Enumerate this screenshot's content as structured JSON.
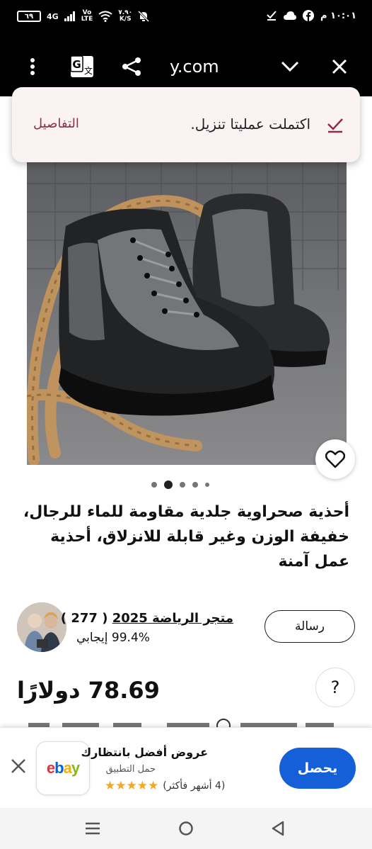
{
  "status_bar": {
    "battery": "٦٩",
    "network": "4G",
    "volte_top": "Vo",
    "volte_bottom": "LTE",
    "speed_top": "٧.٩٠",
    "speed_bottom": "K/S",
    "time": "١٠:٠١ م"
  },
  "toolbar": {
    "url": "y.com"
  },
  "download_snackbar": {
    "message": "اكتملت عمليتا تنزيل.",
    "details_label": "التفاصيل"
  },
  "product": {
    "title": "أحذية صحراوية جلدية مقاومة للماء للرجال، خفيفة الوزن وغير قابلة للانزلاق، أحذية عمل آمنة",
    "image_count": 5,
    "active_image_index": 1,
    "price": "78.69 دولارًا",
    "help_icon_text": "?"
  },
  "seller": {
    "name": "متجر الرياضة 2025",
    "rating_count": "( 277 )",
    "positive_feedback": "99.4% إيجابي",
    "message_button": "رسالة"
  },
  "app_banner": {
    "title": "عروض أفضل بانتظارك",
    "subtitle": "حمل التطبيق",
    "stars": "★★★★★",
    "rating_note": "(4 أشهر فأكثر)",
    "get_button": "يحصل",
    "logo_letters": [
      "e",
      "b",
      "a",
      "y"
    ],
    "logo_colors": [
      "#e53238",
      "#0064d2",
      "#f5af02",
      "#86b817"
    ]
  },
  "colors": {
    "accent_blue": "#1560d8",
    "snackbar_bg": "#fbf2f3",
    "details_link": "#8d2e45"
  }
}
